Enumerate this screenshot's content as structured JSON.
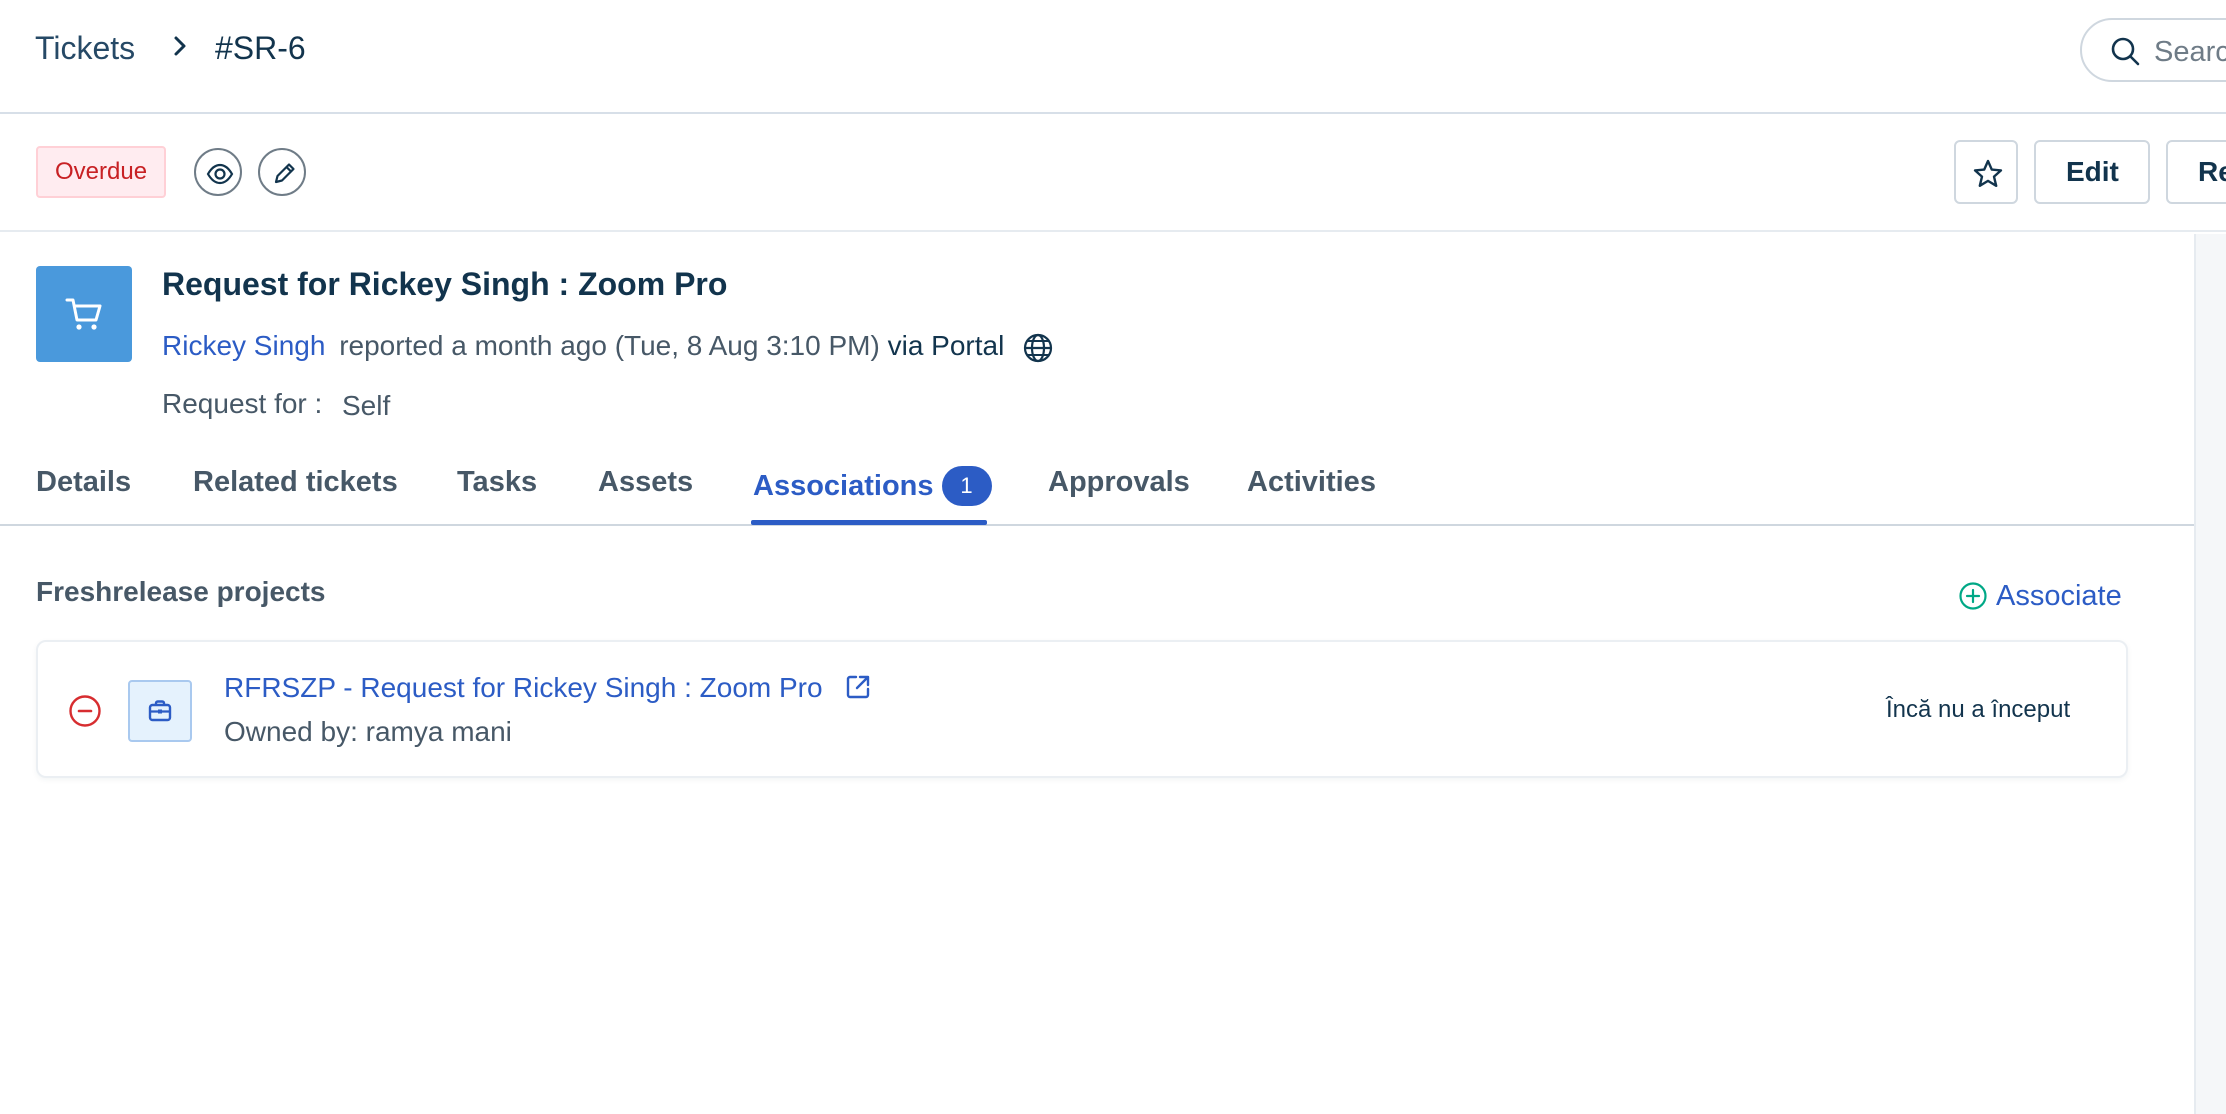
{
  "breadcrumb": {
    "root": "Tickets",
    "current": "#SR-6"
  },
  "search": {
    "placeholder": "Search"
  },
  "actions": {
    "status_badge": "Overdue",
    "edit_label": "Edit",
    "next_label": "Re"
  },
  "ticket": {
    "title": "Request for Rickey Singh : Zoom Pro",
    "requester": "Rickey Singh",
    "reported_text": "reported a month ago (Tue, 8 Aug 3:10 PM)",
    "via": "via Portal",
    "request_for_label": "Request for :",
    "request_for_value": "Self"
  },
  "tabs": [
    {
      "label": "Details"
    },
    {
      "label": "Related tickets"
    },
    {
      "label": "Tasks"
    },
    {
      "label": "Assets"
    },
    {
      "label": "Associations",
      "count": "1",
      "active": true
    },
    {
      "label": "Approvals"
    },
    {
      "label": "Activities"
    }
  ],
  "associations": {
    "section_title": "Freshrelease projects",
    "associate_label": "Associate",
    "items": [
      {
        "title": "RFRSZP - Request for Rickey Singh : Zoom Pro",
        "owner": "Owned by: ramya mani",
        "status": "Încă nu a început"
      }
    ]
  },
  "colors": {
    "accent": "#2c5cc5",
    "ticket_icon_bg": "#4a99dc",
    "overdue_text": "#c82124",
    "associate_icon": "#00a886"
  }
}
